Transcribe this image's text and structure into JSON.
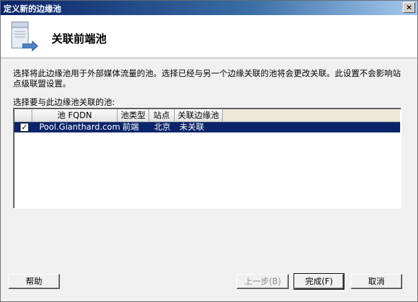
{
  "window": {
    "title": "定义新的边缘池",
    "close_glyph": "×"
  },
  "header": {
    "title": "关联前端池",
    "icon": "server-arrow-icon"
  },
  "description": "选择将此边缘池用于外部媒体流量的池。选择已经与另一个边缘关联的池将会更改关联。此设置不会影响站点级联盟设置。",
  "list_label": "选择要与此边缘池关联的池:",
  "table": {
    "columns": [
      "池 FQDN",
      "池类型",
      "站点",
      "关联边缘池"
    ],
    "rows": [
      {
        "checked": true,
        "check_glyph": "✓",
        "fqdn": "Pool.Gianthard.com",
        "type": "前端",
        "site": "北京",
        "edge": "未关联"
      }
    ]
  },
  "buttons": {
    "help": "帮助",
    "back": "上一步(B)",
    "finish": "完成(F)",
    "cancel": "取消"
  },
  "colors": {
    "selection": "#0a246a",
    "title_gradient_start": "#0a246a"
  }
}
